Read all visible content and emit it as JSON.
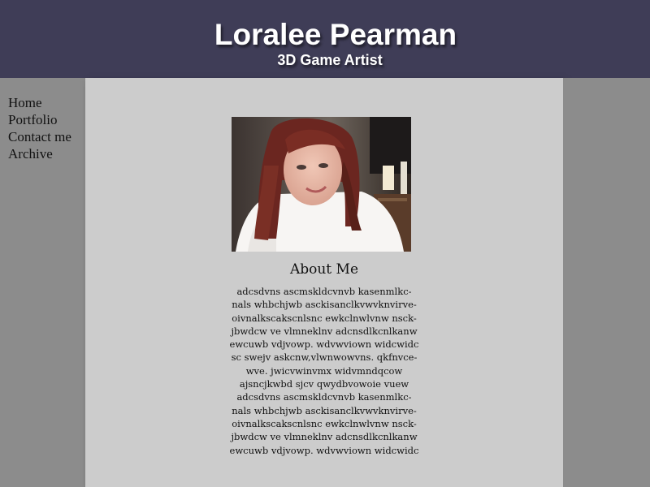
{
  "header": {
    "title": "Loralee Pearman",
    "subtitle": "3D Game Artist"
  },
  "nav": {
    "items": [
      {
        "label": "Home"
      },
      {
        "label": "Portfolio"
      },
      {
        "label": "Contact me"
      },
      {
        "label": "Archive"
      }
    ]
  },
  "about": {
    "heading": "About Me",
    "body": "adcsdvns ascmskldcvnvb kasenmlkc-\nnals whbchjwb asckisanclkvwvknvirve-\noivnalkscakscnlsnc ewkclnwlvnw nsck-\njbwdcw ve vlmneklnv adcnsdlkcnlkanw\newcuwb vdjvowp. wdvwviown widcwidc\nsc swejv askcnw,vlwnwowvns. qkfnvce-\nwve.  jwicvwinvmx widvmndqcow\najsncjkwbd sjcv qwydbvowoie vuew\nadcsdvns ascmskldcvnvb kasenmlkc-\nnals whbchjwb asckisanclkvwvknvirve-\noivnalkscakscnlsnc ewkclnwlvnw nsck-\njbwdcw ve vlmneklnv adcnsdlkcnlkanw\newcuwb vdjvowp. wdvwviown widcwidc"
  }
}
